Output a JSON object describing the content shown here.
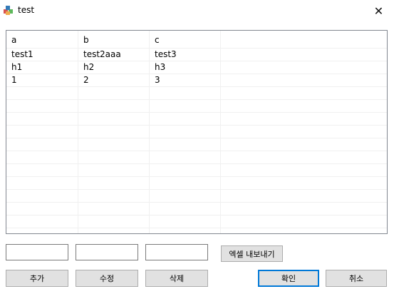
{
  "window": {
    "title": "test",
    "close_glyph": "✕"
  },
  "grid": {
    "columns": [
      "a",
      "b",
      "c"
    ],
    "rows": [
      [
        "test1",
        "test2aaa",
        "test3"
      ],
      [
        "h1",
        "h2",
        "h3"
      ],
      [
        "1",
        "2",
        "3"
      ]
    ]
  },
  "inputs": {
    "field1": "",
    "field2": "",
    "field3": ""
  },
  "buttons": {
    "export_excel": "엑셀 내보내기",
    "add": "추가",
    "edit": "수정",
    "delete": "삭제",
    "ok": "확인",
    "cancel": "취소"
  },
  "colors": {
    "primary_border": "#0078d7",
    "button_bg": "#e1e1e1"
  }
}
